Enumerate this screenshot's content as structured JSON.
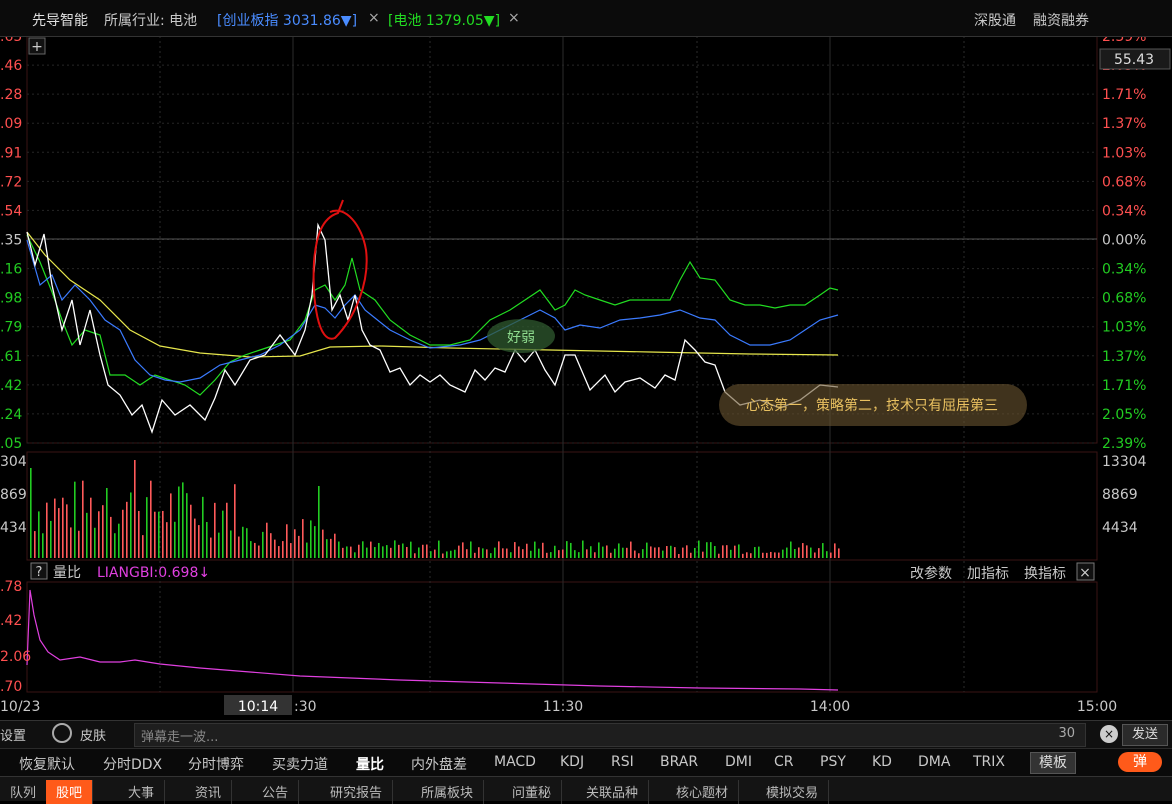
{
  "header": {
    "stock_name": "先导智能",
    "industry_label": "所属行业: 电池",
    "index1": "[创业板指 3031.86▼]",
    "index2": "[电池 1379.05▼]",
    "close_mark": "×",
    "right1": "深股通",
    "right2": "融资融券"
  },
  "price_axis_left": [
    ".65",
    ".46",
    ".28",
    ".09",
    ".91",
    ".72",
    ".54",
    ".35",
    ".16",
    ".98",
    ".79",
    ".61",
    ".42",
    ".24",
    ".05"
  ],
  "pct_axis_right": [
    "2.39%",
    "2.05%",
    "1.71%",
    "1.37%",
    "1.03%",
    "0.68%",
    "0.34%",
    "0.00%",
    "0.34%",
    "0.68%",
    "1.03%",
    "1.37%",
    "1.71%",
    "2.05%",
    "2.39%"
  ],
  "cursor_price": "55.43",
  "volume_axis_left": [
    "304",
    "869",
    "434"
  ],
  "volume_axis_right": [
    "13304",
    "8869",
    "4434"
  ],
  "ind_axis_left": [
    ".78",
    ".42",
    "2.06",
    ".70"
  ],
  "indicator": {
    "help": "?",
    "name": "量比",
    "value": "LIANGBI:0.698↓",
    "btn1": "改参数",
    "btn2": "加指标",
    "btn3": "换指标",
    "close": "×"
  },
  "time_axis": {
    "t0": "10/23",
    "cursor": "10:14",
    "t1": ":30",
    "t2": "11:30",
    "t3": "14:00",
    "t4": "15:00"
  },
  "annotations": {
    "bubble1": "好弱",
    "bubble2": "心态第一，策略第二，技术只有屈居第三"
  },
  "danmaku": {
    "settings": "设置",
    "skin": "皮肤",
    "placeholder": "弹幕走一波...",
    "count": "30",
    "send": "发送"
  },
  "indicator_tabs": [
    "恢复默认",
    "分时DDX",
    "分时博弈",
    "买卖力道",
    "量比",
    "内外盘差",
    "MACD",
    "KDJ",
    "RSI",
    "BRAR",
    "DMI",
    "CR",
    "PSY",
    "KD",
    "DMA",
    "TRIX"
  ],
  "template_btn": "模板",
  "popup_btn": "弹",
  "bottom_tabs": [
    "队列",
    "股吧",
    "大事",
    "资讯",
    "公告",
    "研究报告",
    "所属板块",
    "问董秘",
    "关联品种",
    "核心题材",
    "模拟交易"
  ],
  "colors": {
    "white_line": "#ffffff",
    "yellow_line": "#e6e64c",
    "blue_line": "#3b7bff",
    "green_line": "#22dd22",
    "up": "#ff4040",
    "down": "#22cc22",
    "accent": "#ff6a00",
    "magenta": "#e040e0"
  }
}
